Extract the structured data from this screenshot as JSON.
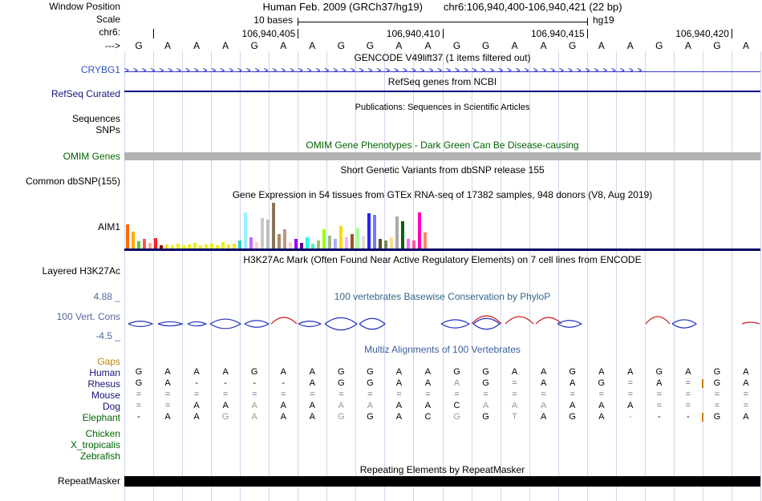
{
  "header": {
    "assembly_title": "Human Feb. 2009 (GRCh37/hg19)",
    "position_range": "chr6:106,940,400-106,940,421 (22 bp)",
    "scale_value": "10 bases",
    "assembly_short": "hg19",
    "bases": [
      "G",
      "A",
      "A",
      "A",
      "G",
      "A",
      "A",
      "G",
      "G",
      "A",
      "A",
      "G",
      "G",
      "A",
      "A",
      "G",
      "A",
      "A",
      "G",
      "A",
      "G",
      "A"
    ],
    "ruler_ticks": [
      {
        "label": "",
        "col": 1
      },
      {
        "label": "106,940,405",
        "col": 6
      },
      {
        "label": "106,940,410",
        "col": 11
      },
      {
        "label": "106,940,415",
        "col": 16
      },
      {
        "label": "106,940,420",
        "col": 21
      }
    ]
  },
  "labels": {
    "window_position": "Window Position",
    "scale": "Scale",
    "chrom": "chr6:",
    "strand": "--->",
    "crybg1": "CRYBG1",
    "refseq_curated": "RefSeq Curated",
    "sequences": "Sequences",
    "snps": "SNPs",
    "omim_genes": "OMIM Genes",
    "common_dbsnp": "Common dbSNP(155)",
    "aim1": "AIM1",
    "layered_h3k27ac": "Layered H3K27Ac",
    "phylop_max": "4.88 _",
    "vert_cons": "100 Vert. Cons",
    "phylop_min": "-4.5 _",
    "repeatmasker": "RepeatMasker"
  },
  "titles": {
    "gencode": "GENCODE V49lift37 (1 items filtered out)",
    "refseq": "RefSeq genes from NCBI",
    "publications": "Publications: Sequences in Scientific Articles",
    "omim": "OMIM Gene Phenotypes - Dark Green Can Be Disease-causing",
    "dbsnp": "Short Genetic Variants from dbSNP release 155",
    "gtex": "Gene Expression in 54 tissues from GTEx RNA-seq of 17382 samples, 948 donors (V8, Aug 2019)",
    "h3k27ac": "H3K27Ac Mark (Often Found Near Active Regulatory Elements) on 7 cell lines from ENCODE",
    "phylop": "100 vertebrates Basewise Conservation by PhyloP",
    "multiz": "Multiz Alignments of 100 Vertebrates",
    "repeatmasker": "Repeating Elements by RepeatMasker"
  },
  "glyphs": {
    "forward_arrow": ">"
  },
  "colors": {
    "guide": "#ccd6ec",
    "crybg1_label": "#2a52be",
    "gencode_item": "#3a3ad0",
    "refseq_label": "#13137a",
    "refseq_line": "#000080",
    "omim_green": "#006400",
    "omim_bar": "#b2b2b2",
    "gene_line": "#000066",
    "phylop_label": "#5566a0",
    "phylop_title": "#33678b",
    "multiz_title": "#3a5fa0",
    "gaps_label": "#b8860b",
    "primate_label": "#13137a",
    "nonmammal_label": "#006400",
    "cons_red": "#cc2020",
    "cons_blue": "#2233bb",
    "gapbar": "#cc7a00",
    "rm_bar": "#000000"
  },
  "chart_data": {
    "gtex_expression": {
      "type": "bar",
      "title": "Gene Expression in 54 tissues from GTEx RNA-seq of 17382 samples, 948 donors (V8, Aug 2019)",
      "gene": "AIM1",
      "tissues_count": 54,
      "bars": [
        {
          "h": 30,
          "c": "#ff6a00"
        },
        {
          "h": 21,
          "c": "#ffaa00"
        },
        {
          "h": 9,
          "c": "#55cc33"
        },
        {
          "h": 12,
          "c": "#ff5555"
        },
        {
          "h": 7,
          "c": "#ffaa99"
        },
        {
          "h": 13,
          "c": "#ff2222"
        },
        {
          "h": 4,
          "c": "#990000"
        },
        {
          "h": 5,
          "c": "#eeee00"
        },
        {
          "h": 4,
          "c": "#eeee00"
        },
        {
          "h": 6,
          "c": "#eeee00"
        },
        {
          "h": 4,
          "c": "#eeee00"
        },
        {
          "h": 5,
          "c": "#eeee00"
        },
        {
          "h": 7,
          "c": "#eeee00"
        },
        {
          "h": 4,
          "c": "#eeee00"
        },
        {
          "h": 5,
          "c": "#eeee00"
        },
        {
          "h": 6,
          "c": "#eeee00"
        },
        {
          "h": 4,
          "c": "#eeee00"
        },
        {
          "h": 8,
          "c": "#eeee00"
        },
        {
          "h": 5,
          "c": "#eeee00"
        },
        {
          "h": 6,
          "c": "#eeee00"
        },
        {
          "h": 10,
          "c": "#33cccc"
        },
        {
          "h": 45,
          "c": "#99eeff"
        },
        {
          "h": 14,
          "c": "#cc66ff"
        },
        {
          "h": 8,
          "c": "#ffcccc"
        },
        {
          "h": 38,
          "c": "#c8c8c8"
        },
        {
          "h": 36,
          "c": "#bdbdbd"
        },
        {
          "h": 57,
          "c": "#8b7355"
        },
        {
          "h": 18,
          "c": "#aa8866"
        },
        {
          "h": 24,
          "c": "#bb9988"
        },
        {
          "h": 8,
          "c": "#ffcccc"
        },
        {
          "h": 12,
          "c": "#9900ff"
        },
        {
          "h": 7,
          "c": "#660099"
        },
        {
          "h": 14,
          "c": "#22ffdd"
        },
        {
          "h": 6,
          "c": "#33ffc2"
        },
        {
          "h": 10,
          "c": "#aabb66"
        },
        {
          "h": 24,
          "c": "#99ff00"
        },
        {
          "h": 16,
          "c": "#99bb88"
        },
        {
          "h": 12,
          "c": "#aaaaff"
        },
        {
          "h": 28,
          "c": "#ffd700"
        },
        {
          "h": 14,
          "c": "#ffaaff"
        },
        {
          "h": 18,
          "c": "#995522"
        },
        {
          "h": 26,
          "c": "#aaff99"
        },
        {
          "h": 16,
          "c": "#dddddd"
        },
        {
          "h": 44,
          "c": "#2222ff"
        },
        {
          "h": 42,
          "c": "#7777ff"
        },
        {
          "h": 12,
          "c": "#555522"
        },
        {
          "h": 10,
          "c": "#778855"
        },
        {
          "h": 14,
          "c": "#ffdd99"
        },
        {
          "h": 40,
          "c": "#aaaaaa"
        },
        {
          "h": 34,
          "c": "#006600"
        },
        {
          "h": 12,
          "c": "#ff66ff"
        },
        {
          "h": 10,
          "c": "#ff5599"
        },
        {
          "h": 45,
          "c": "#ff00bb"
        },
        {
          "h": 20,
          "c": "#ff8866"
        }
      ]
    },
    "conservation": {
      "type": "area",
      "title": "100 vertebrates Basewise Conservation by PhyloP",
      "ylim": [
        -4.5,
        4.88
      ],
      "arcs": [
        {
          "x1": 160,
          "x2": 190,
          "h": 4,
          "color": "blue",
          "shape": "lens"
        },
        {
          "x1": 197,
          "x2": 227,
          "h": 3,
          "color": "blue",
          "shape": "lens"
        },
        {
          "x1": 234,
          "x2": 257,
          "h": 3,
          "color": "blue",
          "shape": "lens"
        },
        {
          "x1": 262,
          "x2": 300,
          "h": 7,
          "color": "blue",
          "shape": "lens"
        },
        {
          "x1": 305,
          "x2": 335,
          "h": 5,
          "color": "blue",
          "shape": "lens"
        },
        {
          "x1": 338,
          "x2": 370,
          "h": 8,
          "color": "red",
          "shape": "arc"
        },
        {
          "x1": 372,
          "x2": 400,
          "h": 4,
          "color": "blue",
          "shape": "lens"
        },
        {
          "x1": 405,
          "x2": 445,
          "h": 9,
          "color": "blue",
          "shape": "lens"
        },
        {
          "x1": 448,
          "x2": 480,
          "h": 8,
          "color": "blue",
          "shape": "lens"
        },
        {
          "x1": 550,
          "x2": 585,
          "h": 6,
          "color": "blue",
          "shape": "lens"
        },
        {
          "x1": 588,
          "x2": 625,
          "h": 10,
          "color": "red",
          "shape": "arc"
        },
        {
          "x1": 590,
          "x2": 623,
          "h": 8,
          "color": "blue",
          "shape": "lens"
        },
        {
          "x1": 630,
          "x2": 665,
          "h": 9,
          "color": "red",
          "shape": "arc"
        },
        {
          "x1": 668,
          "x2": 700,
          "h": 8,
          "color": "red",
          "shape": "arc"
        },
        {
          "x1": 695,
          "x2": 725,
          "h": 5,
          "color": "blue",
          "shape": "lens"
        },
        {
          "x1": 805,
          "x2": 835,
          "h": 9,
          "color": "red",
          "shape": "arc"
        },
        {
          "x1": 838,
          "x2": 868,
          "h": 6,
          "color": "blue",
          "shape": "lens"
        },
        {
          "x1": 925,
          "x2": 947,
          "h": 2,
          "color": "red",
          "shape": "arc"
        }
      ]
    },
    "alignment": {
      "type": "table",
      "title": "Multiz Alignments of 100 Vertebrates",
      "columns": 22,
      "rows": [
        {
          "name": "Gaps",
          "color": "#b8860b",
          "cells": []
        },
        {
          "name": "Human",
          "color": "#13137a",
          "cells": [
            "G",
            "A",
            "A",
            "A",
            "G",
            "A",
            "A",
            "G",
            "G",
            "A",
            "A",
            "G",
            "G",
            "A",
            "A",
            "G",
            "A",
            "A",
            "G",
            "A",
            "G",
            "A"
          ]
        },
        {
          "name": "Rhesus",
          "color": "#13137a",
          "dim": [
            11
          ],
          "gap_before": 21,
          "cells": [
            "G",
            "A",
            "-",
            "-",
            "-",
            "-",
            "A",
            "G",
            "G",
            "A",
            "A",
            "A",
            "G",
            "=",
            "A",
            "A",
            "G",
            "=",
            "A",
            "=",
            "G",
            "A"
          ]
        },
        {
          "name": "Mouse",
          "color": "#13137a",
          "cells": [
            "=",
            "=",
            "=",
            "=",
            "=",
            "=",
            "=",
            "=",
            "=",
            "=",
            "=",
            "=",
            "=",
            "=",
            "=",
            "=",
            "=",
            "=",
            "=",
            "=",
            "=",
            "="
          ]
        },
        {
          "name": "Dog",
          "color": "#13137a",
          "dim": [
            4,
            7,
            8,
            12,
            13,
            14
          ],
          "cells": [
            "=",
            "=",
            "A",
            "A",
            "A",
            "A",
            "A",
            "A",
            "A",
            "A",
            "A",
            "C",
            "A",
            "A",
            "A",
            "A",
            "A",
            "A",
            "=",
            "=",
            "=",
            "="
          ]
        },
        {
          "name": "Elephant",
          "color": "#006400",
          "dim": [
            3,
            4,
            7,
            11,
            13,
            17
          ],
          "gap_before": 21,
          "cells": [
            "-",
            "A",
            "A",
            "G",
            "A",
            "A",
            "A",
            "G",
            "G",
            "A",
            "C",
            "G",
            "G",
            "T",
            "A",
            "G",
            "A",
            "-",
            "-",
            "-",
            "G",
            "A"
          ]
        },
        {
          "name": "Chicken",
          "color": "#006400",
          "cells": []
        },
        {
          "name": "X_tropicalis",
          "color": "#006400",
          "cells": []
        },
        {
          "name": "Zebrafish",
          "color": "#006400",
          "cells": []
        }
      ]
    }
  }
}
